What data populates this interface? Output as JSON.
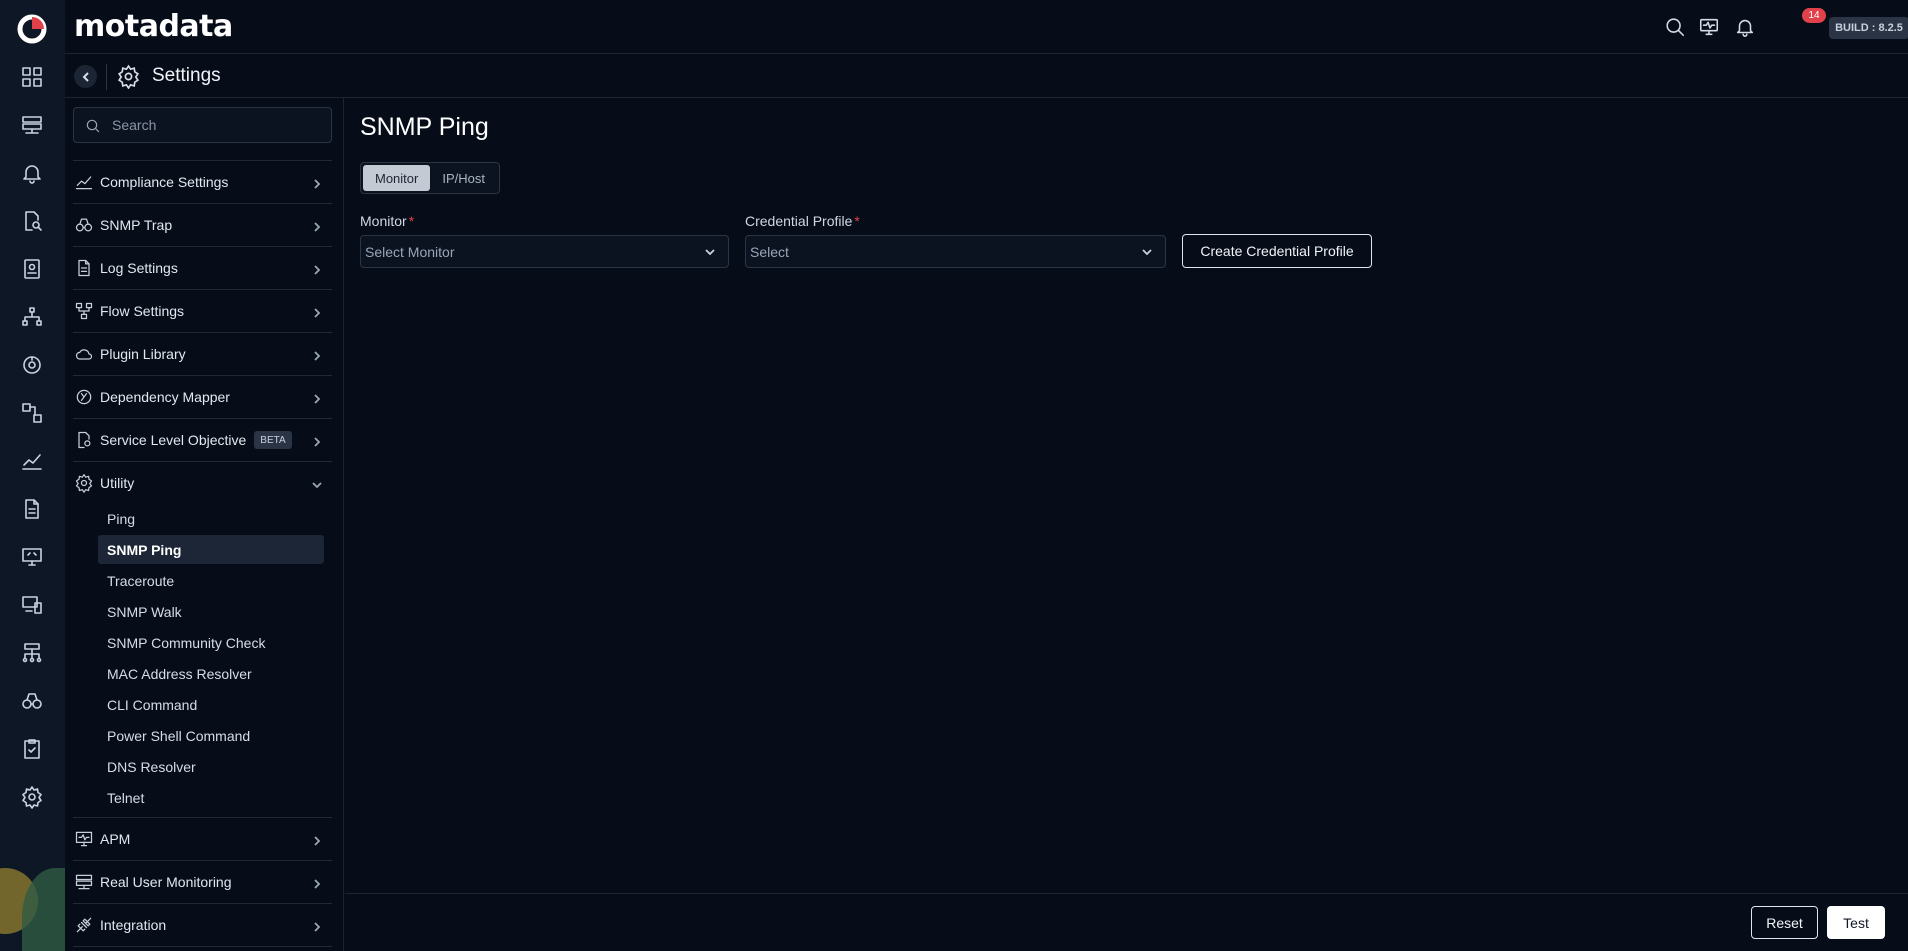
{
  "brand": {
    "name": "motadata"
  },
  "topbar": {
    "notification_count": "14",
    "build_label": "BUILD : 8.2.5"
  },
  "header": {
    "title": "Settings"
  },
  "sidebar": {
    "search_placeholder": "Search",
    "items": [
      {
        "label": "Compliance Settings",
        "icon": "compliance-icon"
      },
      {
        "label": "SNMP Trap",
        "icon": "binoculars-icon"
      },
      {
        "label": "Log Settings",
        "icon": "log-icon"
      },
      {
        "label": "Flow Settings",
        "icon": "flow-icon"
      },
      {
        "label": "Plugin Library",
        "icon": "plugin-cloud-icon"
      },
      {
        "label": "Dependency Mapper",
        "icon": "dependency-icon"
      },
      {
        "label": "Service Level Objective",
        "icon": "slo-icon",
        "badge": "BETA"
      },
      {
        "label": "Utility",
        "icon": "utility-gear-icon",
        "expanded": true
      }
    ],
    "utility_subitems": [
      "Ping",
      "SNMP Ping",
      "Traceroute",
      "SNMP Walk",
      "SNMP Community Check",
      "MAC Address Resolver",
      "CLI Command",
      "Power Shell Command",
      "DNS Resolver",
      "Telnet"
    ],
    "active_subitem": "SNMP Ping",
    "bottom_items": [
      {
        "label": "APM",
        "icon": "apm-icon"
      },
      {
        "label": "Real User Monitoring",
        "icon": "rum-icon"
      },
      {
        "label": "Integration",
        "icon": "integration-icon"
      }
    ]
  },
  "main": {
    "title": "SNMP Ping",
    "tabs": [
      {
        "label": "Monitor",
        "active": true
      },
      {
        "label": "IP/Host",
        "active": false
      }
    ],
    "monitor_label": "Monitor",
    "monitor_placeholder": "Select Monitor",
    "credential_label": "Credential Profile",
    "credential_placeholder": "Select",
    "required_mark": "*",
    "create_credential_button": "Create Credential Profile"
  },
  "footer": {
    "reset_label": "Reset",
    "test_label": "Test"
  },
  "colors": {
    "background": "#060d19",
    "rail": "#0e1726",
    "required": "#e0414a",
    "badge": "#e0414a"
  }
}
